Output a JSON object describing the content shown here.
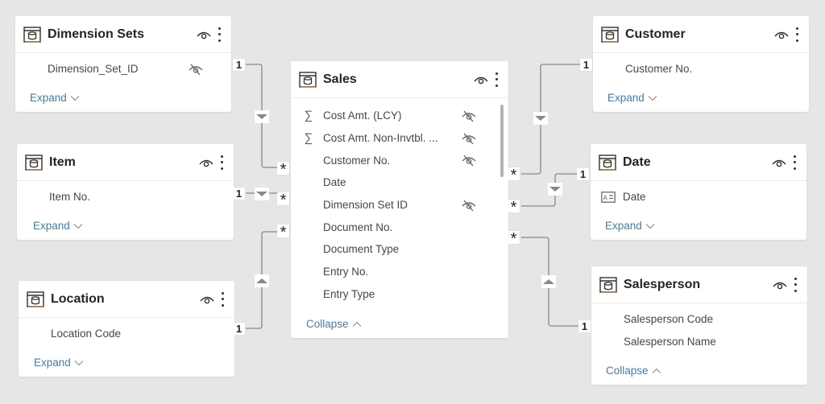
{
  "colors": {
    "canvas": "#e6e6e6",
    "card": "#ffffff",
    "line": "#8a8886",
    "link": "#4a7a9b",
    "icon_accent": "#c67b2a"
  },
  "tables": {
    "dimension_sets": {
      "title": "Dimension Sets",
      "fields": [
        {
          "name": "Dimension_Set_ID",
          "hidden": true
        }
      ],
      "toggle": "Expand"
    },
    "item": {
      "title": "Item",
      "fields": [
        {
          "name": "Item No.",
          "hidden": false
        }
      ],
      "toggle": "Expand"
    },
    "location": {
      "title": "Location",
      "fields": [
        {
          "name": "Location Code",
          "hidden": false
        }
      ],
      "toggle": "Expand"
    },
    "sales": {
      "title": "Sales",
      "fields": [
        {
          "name": "Cost Amt. (LCY)",
          "icon": "∑",
          "hidden": true
        },
        {
          "name": "Cost Amt. Non-Invtbl. ...",
          "icon": "∑",
          "hidden": true
        },
        {
          "name": "Customer No.",
          "hidden": true
        },
        {
          "name": "Date",
          "hidden": false
        },
        {
          "name": "Dimension Set ID",
          "hidden": true
        },
        {
          "name": "Document No.",
          "hidden": false
        },
        {
          "name": "Document Type",
          "hidden": false
        },
        {
          "name": "Entry No.",
          "hidden": false
        },
        {
          "name": "Entry Type",
          "hidden": false
        }
      ],
      "toggle": "Collapse"
    },
    "customer": {
      "title": "Customer",
      "fields": [
        {
          "name": "Customer No.",
          "hidden": false
        }
      ],
      "toggle": "Expand"
    },
    "date": {
      "title": "Date",
      "fields": [
        {
          "name": "Date",
          "icon": "text-field-icon",
          "hidden": false
        }
      ],
      "toggle": "Expand"
    },
    "salesperson": {
      "title": "Salesperson",
      "fields": [
        {
          "name": "Salesperson Code",
          "hidden": false
        },
        {
          "name": "Salesperson Name",
          "hidden": false
        }
      ],
      "toggle": "Collapse"
    }
  },
  "relationships": [
    {
      "from": "Dimension Sets",
      "to": "Sales",
      "one": "1",
      "many": "*",
      "direction": "down"
    },
    {
      "from": "Item",
      "to": "Sales",
      "one": "1",
      "many": "*",
      "direction": "down"
    },
    {
      "from": "Location",
      "to": "Sales",
      "one": "1",
      "many": "*",
      "direction": "up"
    },
    {
      "from": "Customer",
      "to": "Sales",
      "one": "1",
      "many": "*",
      "direction": "down"
    },
    {
      "from": "Date",
      "to": "Sales",
      "one": "1",
      "many": "*",
      "direction": "down"
    },
    {
      "from": "Salesperson",
      "to": "Sales",
      "one": "1",
      "many": "*",
      "direction": "up"
    }
  ]
}
